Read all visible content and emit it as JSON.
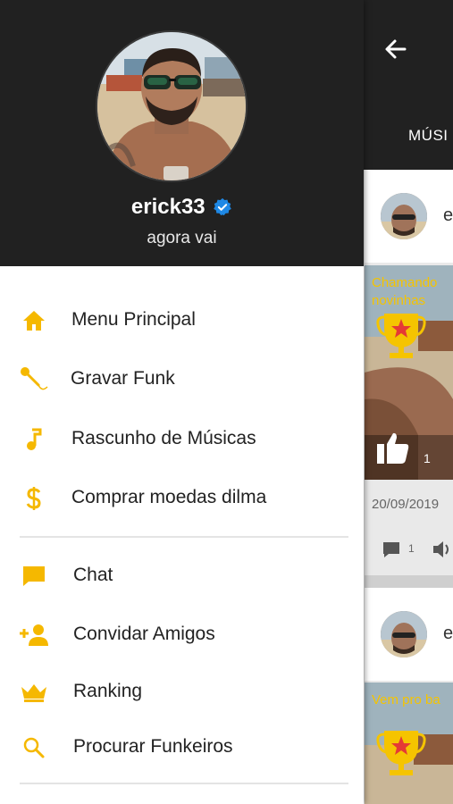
{
  "app": {
    "tab_label": "MÚSI",
    "posts": [
      {
        "author_initial": "e",
        "thumb_title_line1": "Chamando",
        "thumb_title_line2": "novinhas",
        "likes": "1",
        "date": "20/09/2019",
        "comments": "1"
      },
      {
        "author_initial": "e",
        "thumb_title_line1": "Vem pro ba"
      }
    ]
  },
  "drawer": {
    "username": "erick33",
    "status": "agora vai",
    "items": [
      {
        "label": "Menu Principal",
        "icon": "home-icon"
      },
      {
        "label": "Gravar Funk",
        "icon": "microphone-icon"
      },
      {
        "label": "Rascunho de Músicas",
        "icon": "music-note-icon"
      },
      {
        "label": "Comprar moedas dilma",
        "icon": "dollar-icon"
      },
      {
        "label": "Chat",
        "icon": "chat-icon"
      },
      {
        "label": "Convidar Amigos",
        "icon": "add-person-icon"
      },
      {
        "label": "Ranking",
        "icon": "crown-icon"
      },
      {
        "label": "Procurar Funkeiros",
        "icon": "search-icon"
      }
    ]
  },
  "colors": {
    "accent": "#f5b800",
    "header": "#212121",
    "verified": "#1e88e5"
  }
}
